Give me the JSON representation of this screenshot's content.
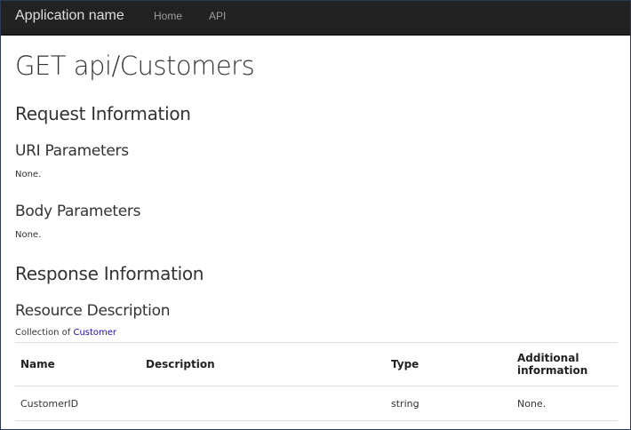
{
  "navbar": {
    "brand": "Application name",
    "links": [
      "Home",
      "API"
    ]
  },
  "page": {
    "title": "GET api/Customers",
    "request_info_heading": "Request Information",
    "uri_params_heading": "URI Parameters",
    "uri_params_value": "None.",
    "body_params_heading": "Body Parameters",
    "body_params_value": "None.",
    "response_info_heading": "Response Information",
    "resource_desc_heading": "Resource Description",
    "collection_prefix": "Collection of",
    "collection_link": "Customer"
  },
  "table": {
    "headers": [
      "Name",
      "Description",
      "Type",
      "Additional information"
    ],
    "rows": [
      [
        "CustomerID",
        "",
        "string",
        "None."
      ]
    ]
  },
  "colors": {
    "navbar_bg": "#222222",
    "brand": "#dddddd",
    "nav_link": "#9d9d9d",
    "link": "#1a0dab"
  }
}
